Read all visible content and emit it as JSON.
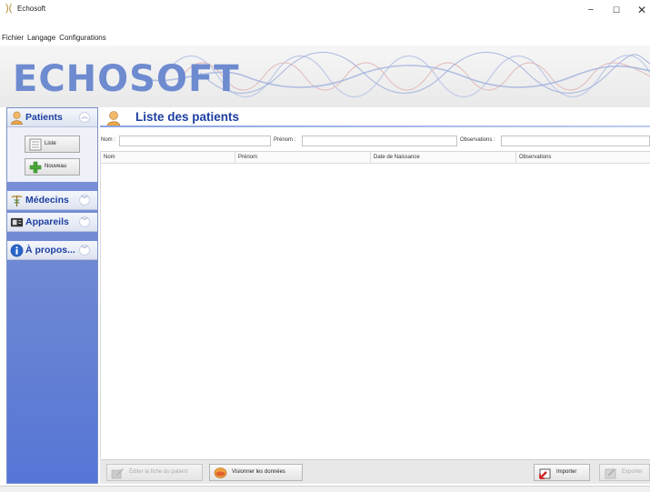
{
  "window": {
    "title": "Echosoft",
    "min_glyph": "−",
    "max_glyph": "☐",
    "close_glyph": "✕"
  },
  "menu": {
    "items": [
      "Fichier",
      "Langage",
      "Configurations"
    ]
  },
  "banner": {
    "logo_text": "ECHOSOFT"
  },
  "sidebar": {
    "sections": [
      {
        "label": "Patients",
        "icon": "patient-icon",
        "expanded": true
      },
      {
        "label": "Médecins",
        "icon": "caduceus-icon",
        "expanded": false
      },
      {
        "label": "Appareils",
        "icon": "device-icon",
        "expanded": false
      },
      {
        "label": "À propos...",
        "icon": "info-icon",
        "expanded": false
      }
    ],
    "patients_items": [
      {
        "label": "Liste",
        "icon": "list-icon"
      },
      {
        "label": "Nouveau",
        "icon": "plus-icon"
      }
    ]
  },
  "main": {
    "title": "Liste des patients",
    "filters": {
      "nom_label": "Nom :",
      "prenom_label": "Prénom :",
      "observations_label": "Observations :",
      "nom_value": "",
      "prenom_value": "",
      "observations_value": ""
    },
    "table": {
      "columns": [
        "Nom",
        "Prénom",
        "Date de Naissance",
        "Observations"
      ],
      "rows": []
    }
  },
  "toolbar": {
    "edit_label": "Éditer la fiche du patient",
    "view_label": "Visionner les données",
    "import_label": "Importer",
    "export_label": "Exporter"
  },
  "colors": {
    "accent": "#1c3ea0",
    "sidebar": "#6c85d3",
    "logo": "#6e8bd0"
  }
}
